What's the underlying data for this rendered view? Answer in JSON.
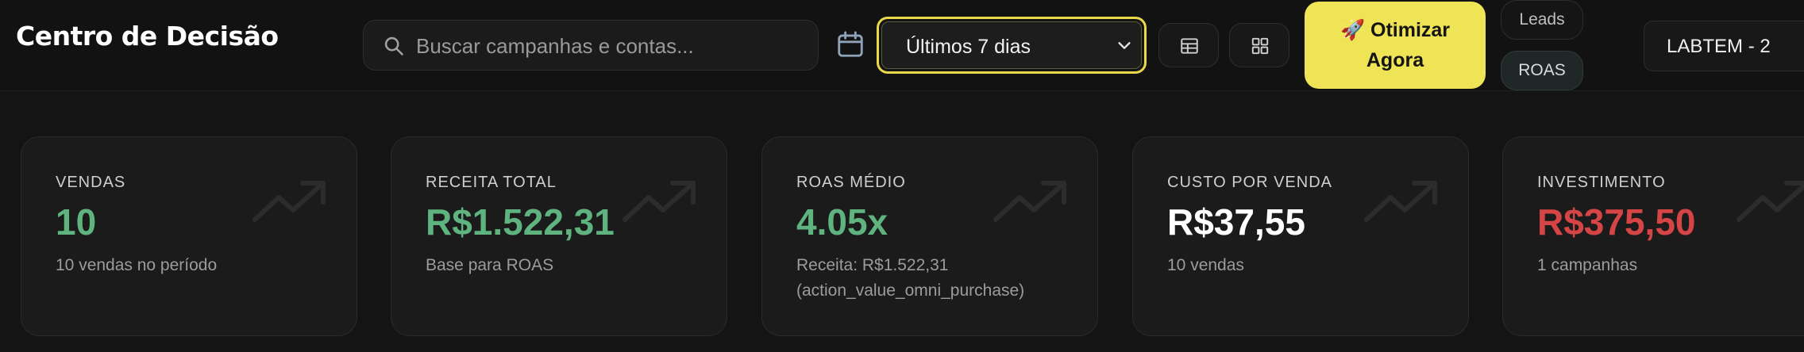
{
  "header": {
    "title": "Centro de Decisão",
    "search_placeholder": "Buscar campanhas e contas...",
    "date_range": "Últimos 7 dias",
    "optimize_label": "🚀 Otimizar Agora",
    "mode_leads": "Leads",
    "mode_roas": "ROAS",
    "account": "LABTEM - 2"
  },
  "icons": {
    "search": "search-icon",
    "calendar": "calendar-icon",
    "table_view": "table-icon",
    "grid_view": "grid-icon",
    "dropdown": "chevron-down-icon",
    "trend": "trending-up-icon"
  },
  "colors": {
    "accent_yellow": "#efe455",
    "positive_green": "#5fb37f",
    "negative_red": "#d64545",
    "background": "#141414"
  },
  "metrics": [
    {
      "label": "VENDAS",
      "value": "10",
      "sub": "10 vendas no período",
      "color": "green"
    },
    {
      "label": "RECEITA TOTAL",
      "value": "R$1.522,31",
      "sub": "Base para ROAS",
      "color": "green"
    },
    {
      "label": "ROAS MÉDIO",
      "value": "4.05x",
      "sub": "Receita: R$1.522,31 (action_value_omni_purchase)",
      "color": "green"
    },
    {
      "label": "CUSTO POR VENDA",
      "value": "R$37,55",
      "sub": "10 vendas",
      "color": "white"
    },
    {
      "label": "INVESTIMENTO",
      "value": "R$375,50",
      "sub": "1 campanhas",
      "color": "red"
    }
  ]
}
